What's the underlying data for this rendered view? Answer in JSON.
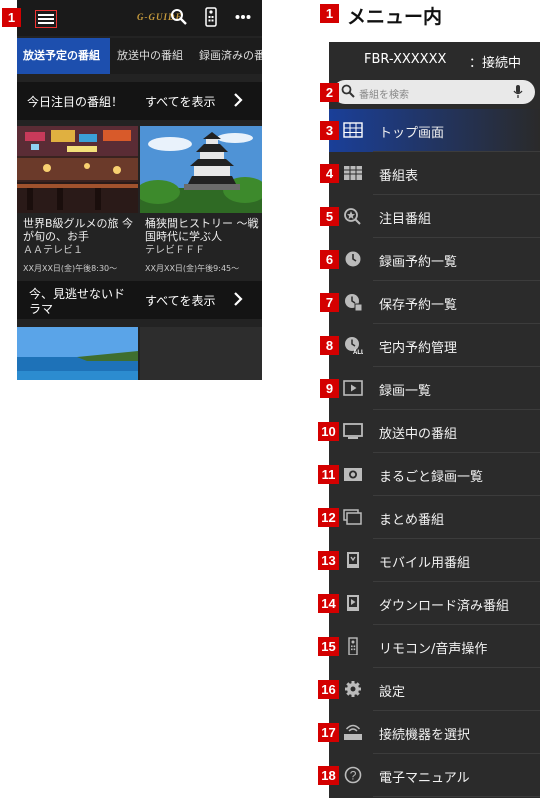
{
  "left": {
    "badge": "1",
    "logo": "G-GUIDE",
    "tabs": [
      "放送予定の番組",
      "放送中の番組",
      "録画済みの番組"
    ],
    "section1": {
      "title": "今日注目の番組！",
      "show_all": "すべてを表示"
    },
    "cards": [
      {
        "title": "世界B級グルメの旅 今が旬の、お手",
        "channel": "ＡＡテレビ１",
        "time": "XX月XX日(金)午後8:30～"
      },
      {
        "title": "桶狭間ヒストリー ～戦国時代に学ぶ人",
        "channel": "テレビＦＦＦ",
        "time": "XX月XX日(金)午後9:45～"
      }
    ],
    "section2": {
      "title": "今、見逃せないドラマ",
      "show_all": "すべてを表示"
    }
  },
  "menu": {
    "title_badge": "1",
    "title": "メニュー内",
    "device": "FBR-XXXXXX",
    "status": "：接続中",
    "search_badge": "2",
    "search_placeholder": "番組を検索",
    "items": [
      {
        "num": "3",
        "label": "トップ画面",
        "icon": "grid-icon"
      },
      {
        "num": "4",
        "label": "番組表",
        "icon": "table-icon"
      },
      {
        "num": "5",
        "label": "注目番組",
        "icon": "spotlight-icon"
      },
      {
        "num": "6",
        "label": "録画予約一覧",
        "icon": "clock-icon"
      },
      {
        "num": "7",
        "label": "保存予約一覧",
        "icon": "clock-save-icon"
      },
      {
        "num": "8",
        "label": "宅内予約管理",
        "icon": "clock-all-icon"
      },
      {
        "num": "9",
        "label": "録画一覧",
        "icon": "play-icon"
      },
      {
        "num": "10",
        "label": "放送中の番組",
        "icon": "tv-icon"
      },
      {
        "num": "11",
        "label": "まるごと録画一覧",
        "icon": "camera-icon"
      },
      {
        "num": "12",
        "label": "まとめ番組",
        "icon": "stack-icon"
      },
      {
        "num": "13",
        "label": "モバイル用番組",
        "icon": "mobile-icon"
      },
      {
        "num": "14",
        "label": "ダウンロード済み番組",
        "icon": "download-icon"
      },
      {
        "num": "15",
        "label": "リモコン/音声操作",
        "icon": "remote-icon"
      },
      {
        "num": "16",
        "label": "設定",
        "icon": "gear-icon"
      },
      {
        "num": "17",
        "label": "接続機器を選択",
        "icon": "router-icon"
      },
      {
        "num": "18",
        "label": "電子マニュアル",
        "icon": "help-icon"
      }
    ]
  }
}
